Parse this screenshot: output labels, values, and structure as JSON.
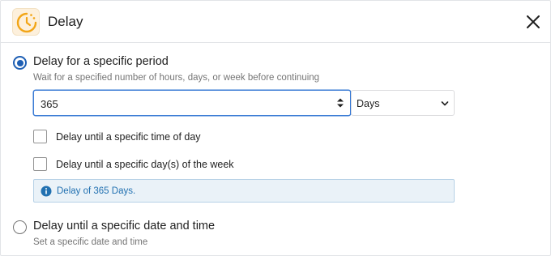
{
  "header": {
    "title": "Delay",
    "app_icon": "clock-icon",
    "close_icon": "close-icon"
  },
  "option_specific_period": {
    "label": "Delay for a specific period",
    "help": "Wait for a specified number of hours, days, or week before continuing",
    "selected": true,
    "amount_value": "365",
    "unit_value": "Days",
    "checkboxes": [
      {
        "label": "Delay until a specific time of day",
        "checked": false
      },
      {
        "label": "Delay until a specific day(s) of the week",
        "checked": false
      }
    ],
    "notice": "Delay of 365 Days."
  },
  "option_specific_date": {
    "label": "Delay until a specific date and time",
    "help": "Set a specific date and time",
    "selected": false
  },
  "colors": {
    "accent": "#1e5fb4",
    "icon_orange": "#f2a516",
    "notice_bg": "#eaf2f8",
    "notice_text": "#2271b1"
  }
}
